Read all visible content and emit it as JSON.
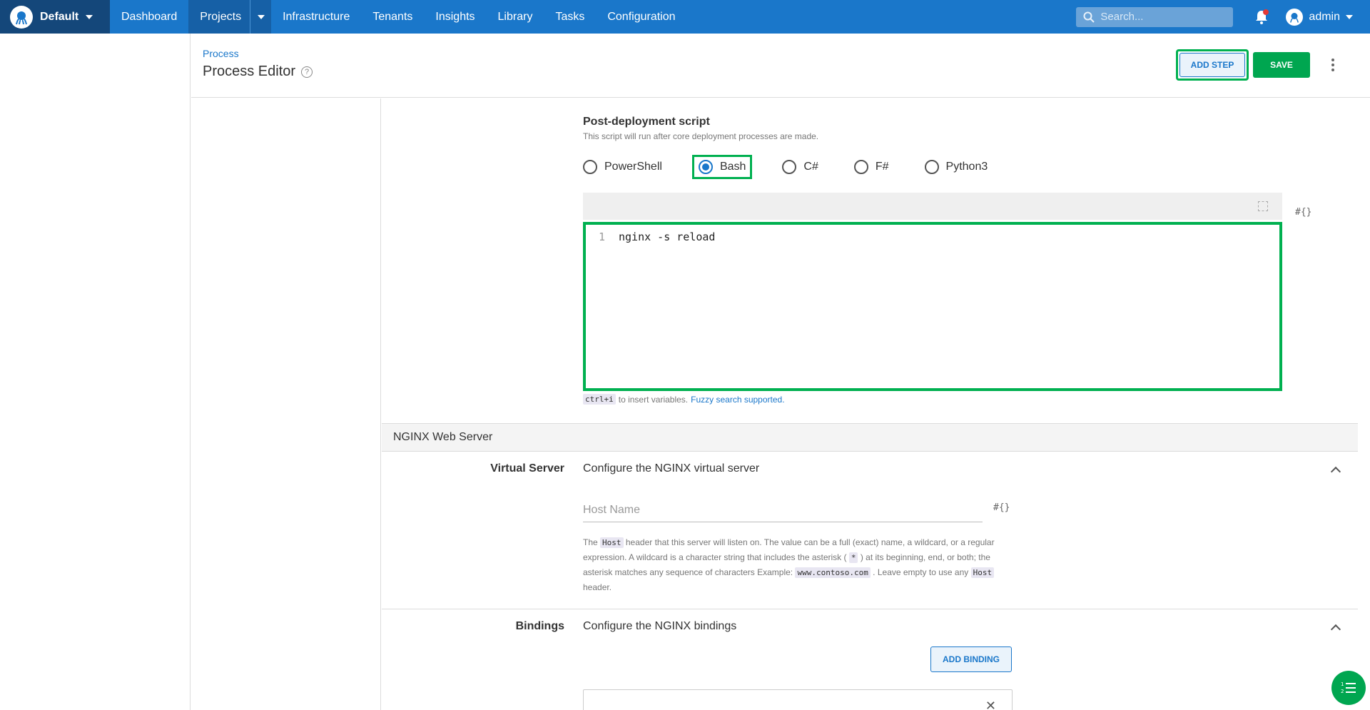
{
  "topnav": {
    "space": "Default",
    "items": [
      {
        "label": "Dashboard"
      },
      {
        "label": "Projects"
      },
      {
        "label": "Infrastructure"
      },
      {
        "label": "Tenants"
      },
      {
        "label": "Insights"
      },
      {
        "label": "Library"
      },
      {
        "label": "Tasks"
      },
      {
        "label": "Configuration"
      }
    ],
    "search_placeholder": "Search...",
    "user": "admin"
  },
  "header": {
    "breadcrumb": "Process",
    "title": "Process Editor",
    "add_step_label": "ADD STEP",
    "save_label": "SAVE"
  },
  "script": {
    "title": "Post-deployment script",
    "description": "This script will run after core deployment processes are made.",
    "languages": [
      "PowerShell",
      "Bash",
      "C#",
      "F#",
      "Python3"
    ],
    "selected_language": "Bash",
    "line_number": "1",
    "code": "nginx -s reload",
    "var_icon": "#{}",
    "hint_key": "ctrl+i",
    "hint_text": "to insert variables.",
    "hint_link": "Fuzzy search supported."
  },
  "nginx": {
    "group_title": "NGINX Web Server",
    "virtual_server": {
      "label": "Virtual Server",
      "summary": "Configure the NGINX virtual server",
      "host_placeholder": "Host Name",
      "var_icon": "#{}",
      "help_1": "The",
      "help_code_host": "Host",
      "help_2": "header that this server will listen on. The value can be a full (exact) name, a wildcard, or a regular expression. A wildcard is a character string that includes the asterisk (",
      "help_code_star": "*",
      "help_3": ") at its beginning, end, or both; the asterisk matches any sequence of characters Example:",
      "help_code_example": "www.contoso.com",
      "help_4": ". Leave empty to use any",
      "help_code_host2": "Host",
      "help_5": "header."
    },
    "bindings": {
      "label": "Bindings",
      "summary": "Configure the NGINX bindings",
      "add_binding_label": "ADD BINDING"
    }
  },
  "icons": {
    "accent": "#1a77ca",
    "highlight": "#00b050",
    "save": "#00a650"
  }
}
